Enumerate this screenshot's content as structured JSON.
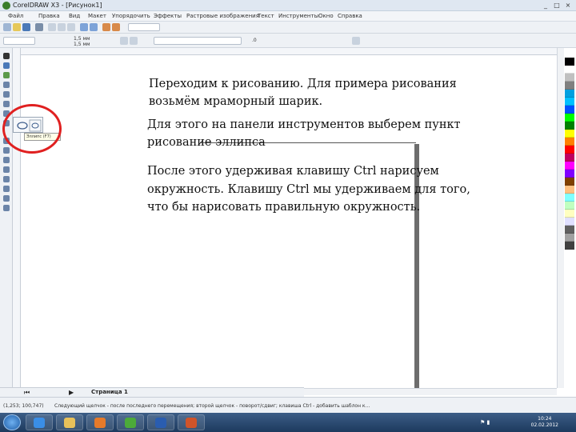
{
  "window": {
    "title": "CorelDRAW X3 - [Рисунок1]",
    "controls": [
      "_",
      "□",
      "×"
    ]
  },
  "menu": [
    "Файл",
    "Правка",
    "Вид",
    "Макет",
    "Упорядочить",
    "Эффекты",
    "Растровые изображения",
    "Текст",
    "Инструменты",
    "Окно",
    "Справка"
  ],
  "property_bar": {
    "width_value": "1,5 мм",
    "height_value": "1,5 мм",
    "rotation_value": ".0"
  },
  "page_tab": "Страница 1",
  "status_text": "Следующий щелчок - после последнего перемещения; второй щелчок - поворот/сдвиг; клавиша Ctrl - добавить шаблон к...",
  "cursor_position": "(1,253; 100,747)",
  "tooltip": "Эллипс (F7)",
  "annotations": [
    "Переходим к рисованию. Для примера рисования",
    "возьмём мраморный шарик.",
    "Для этого на панели инструментов  выберем пункт",
    "рисование эллипса",
    "После этого удерживая клавишу Ctrl нарисуем",
    "окружность. Клавишу Ctrl мы удерживаем для того,",
    "что бы нарисовать правильную окружность."
  ],
  "clock": {
    "time": "10:24",
    "date": "02.02.2012"
  },
  "colors": {
    "highlight_circle": "#e02020",
    "taskbar": "#2a4a72"
  },
  "palette_colors": [
    "#000000",
    "#ffffff",
    "#c0c0c0",
    "#808080",
    "#00a0e0",
    "#00c0ff",
    "#0050ff",
    "#00ff00",
    "#008000",
    "#ffff00",
    "#ff8000",
    "#ff0000",
    "#c00060",
    "#ff00ff",
    "#8000ff",
    "#804000",
    "#ffc080",
    "#80ffff",
    "#c0ffc0",
    "#ffffc0",
    "#e0e0ff",
    "#606060",
    "#a0a0a0",
    "#404040"
  ]
}
